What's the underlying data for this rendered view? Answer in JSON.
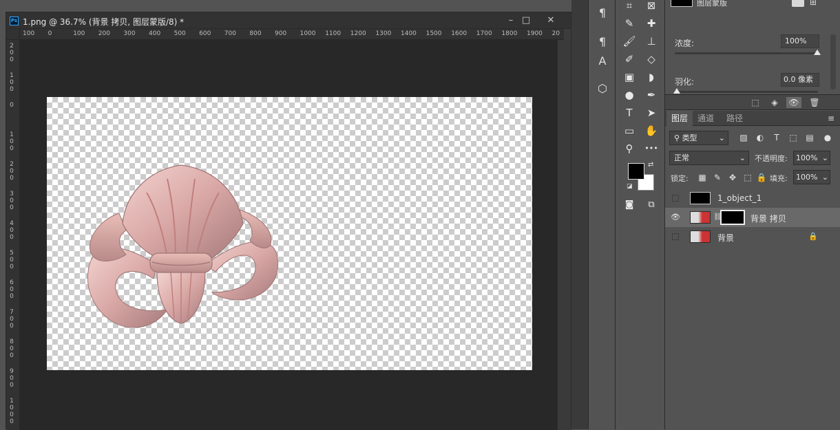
{
  "document": {
    "app_icon": "Ps",
    "title": "1.png @ 36.7% (背景 拷贝, 图层蒙版/8) *",
    "minimize": "–",
    "restore": "□",
    "close": "✕"
  },
  "ruler": {
    "h_labels": [
      "100",
      "0",
      "100",
      "200",
      "300",
      "400",
      "500",
      "600",
      "700",
      "800",
      "900",
      "1000",
      "1100",
      "1200",
      "1300",
      "1400",
      "1500",
      "1600",
      "1700",
      "1800",
      "1900",
      "20"
    ],
    "v_labels": [
      "200",
      "100",
      "0",
      "100",
      "200",
      "300",
      "400",
      "500",
      "600",
      "700",
      "800",
      "900",
      "1000"
    ]
  },
  "panel_strip": {
    "icons": [
      "paragraph-icon",
      "paragraph-styles-icon",
      "character-styles-icon",
      "3d-icon"
    ]
  },
  "tools": {
    "icons": [
      "crop-icon",
      "frame-icon",
      "eyedropper-icon",
      "healing-brush-icon",
      "brush-icon",
      "stamp-icon",
      "history-brush-icon",
      "eraser-icon",
      "gradient-icon",
      "blur-icon",
      "dodge-icon",
      "pen-icon",
      "type-icon",
      "path-selection-icon",
      "rectangle-icon",
      "hand-icon",
      "zoom-icon",
      "more-icon",
      "quickmask-icon",
      "screenmode-icon"
    ],
    "type_glyph": "T",
    "more_glyph": "•••"
  },
  "properties": {
    "mask_label": "图层蒙版",
    "density_label": "浓度:",
    "density_value": "100%",
    "feather_label": "羽化:",
    "feather_value": "0.0 像素"
  },
  "layers_panel": {
    "tabs": [
      "图层",
      "通道",
      "路径"
    ],
    "filter_label": "类型",
    "blend_mode": "正常",
    "opacity_label": "不透明度:",
    "opacity_value": "100%",
    "lock_label": "锁定:",
    "fill_label": "填充:",
    "fill_value": "100%",
    "layers": [
      {
        "name": "1_object_1",
        "visible": false,
        "selected": false
      },
      {
        "name": "背景 拷贝",
        "visible": true,
        "selected": true
      },
      {
        "name": "背景",
        "visible": false,
        "selected": false,
        "locked": true
      }
    ]
  },
  "colors": {
    "foreground": "#000000",
    "background": "#ffffff",
    "object_tint": "#d9a8a6"
  }
}
